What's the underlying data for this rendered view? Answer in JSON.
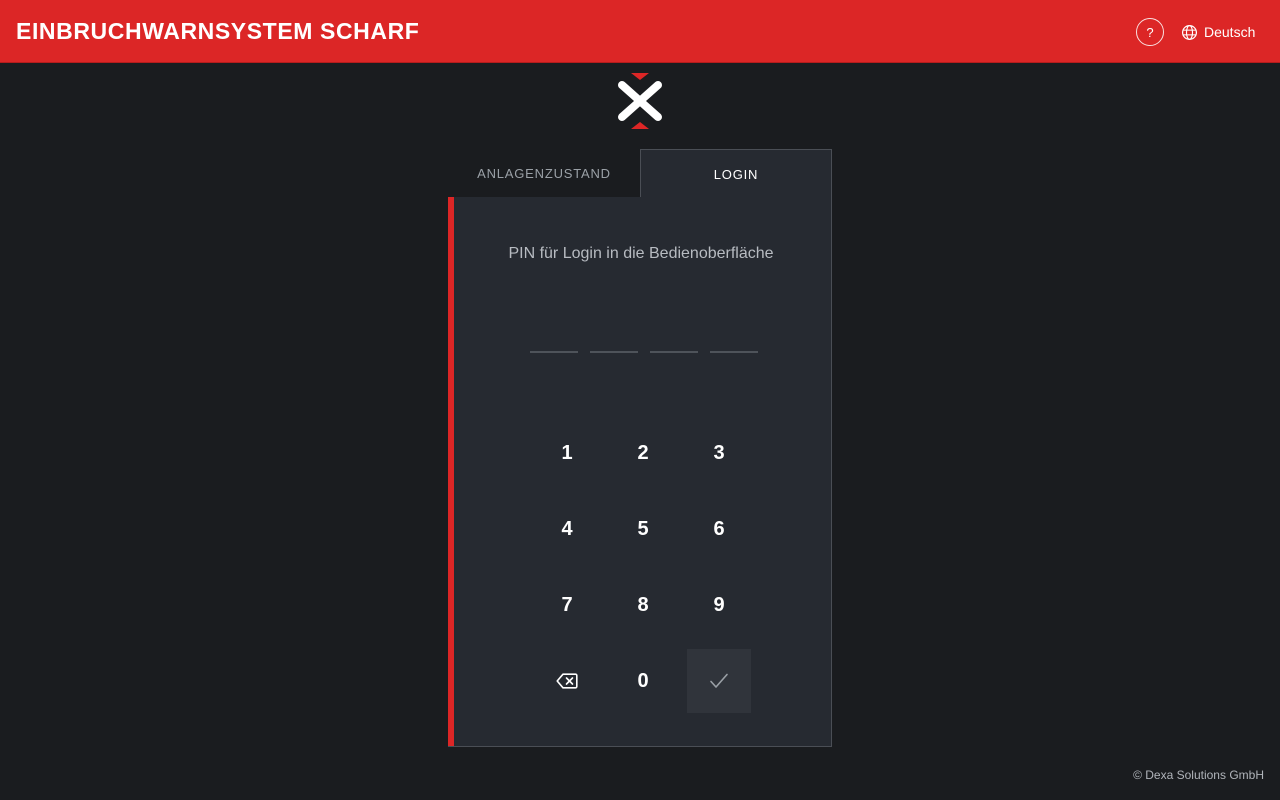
{
  "header": {
    "title": "EINBRUCHWARNSYSTEM SCHARF",
    "help_label": "?",
    "language_label": "Deutsch",
    "help_icon": "help-icon",
    "language_icon": "globe-icon",
    "background_color": "#dc2626"
  },
  "logo": {
    "icon": "dexa-x-logo",
    "accent_color": "#dc2626"
  },
  "tabs": [
    {
      "label": "ANLAGENZUSTAND",
      "active": false
    },
    {
      "label": "LOGIN",
      "active": true
    }
  ],
  "login": {
    "prompt": "PIN für Login in die Bedienoberfläche",
    "pin_length": 4,
    "pin_value": "",
    "keypad": {
      "keys": [
        "1",
        "2",
        "3",
        "4",
        "5",
        "6",
        "7",
        "8",
        "9",
        "0"
      ],
      "backspace_icon": "backspace-icon",
      "submit_icon": "checkmark-icon"
    }
  },
  "footer": {
    "copyright": "© Dexa Solutions GmbH"
  }
}
